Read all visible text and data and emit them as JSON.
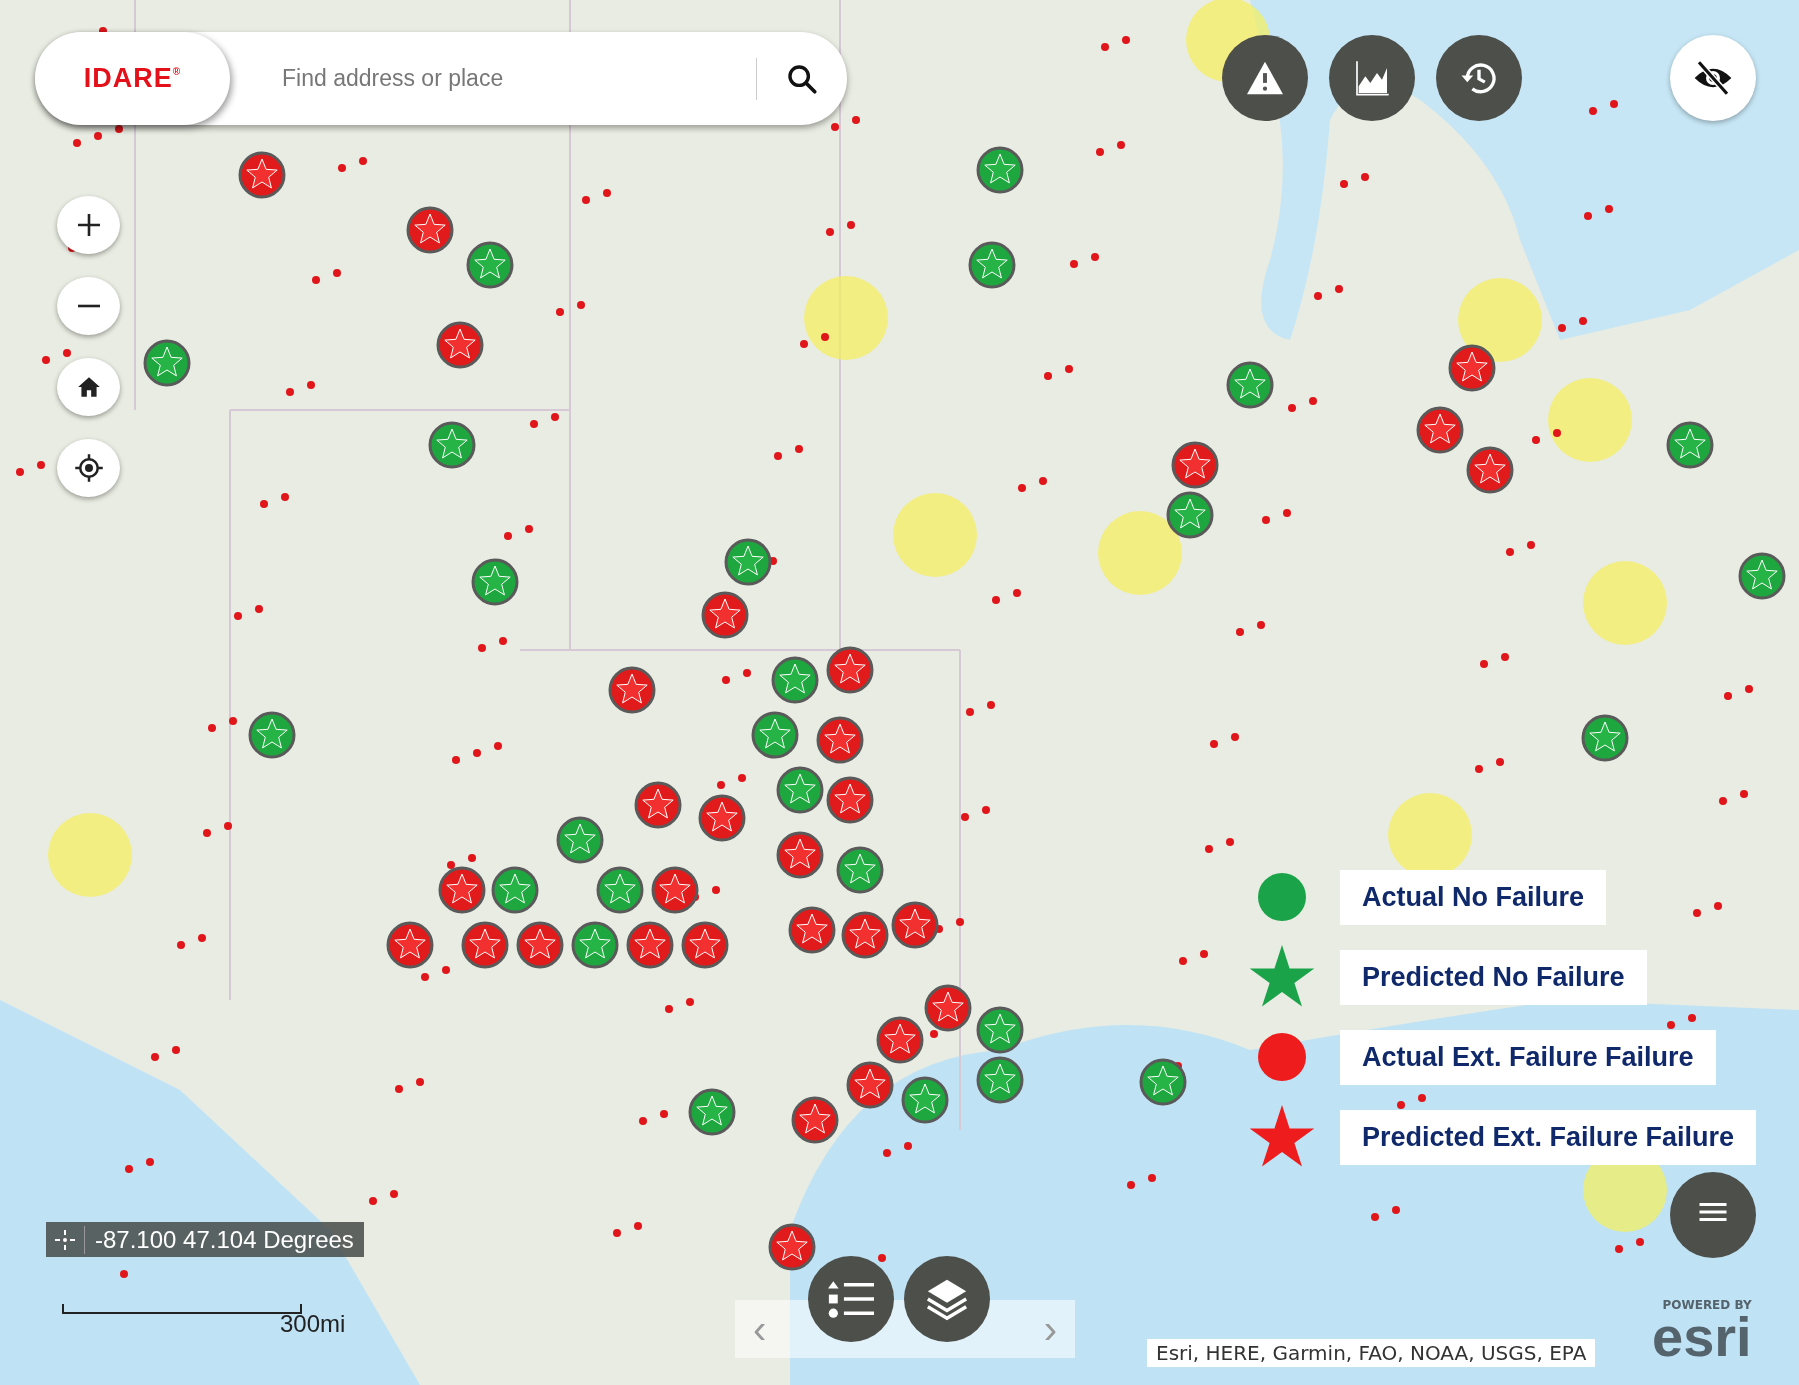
{
  "header": {
    "logo": "IDARE",
    "logo_mark": "®",
    "search": {
      "placeholder": "Find address or place"
    }
  },
  "legend": [
    {
      "kind": "circle",
      "color": "#1ba34a",
      "label": "Actual No Failure"
    },
    {
      "kind": "star",
      "color": "#1ba34a",
      "label": "Predicted No Failure"
    },
    {
      "kind": "circle",
      "color": "#ee1c1c",
      "label": "Actual Ext. Failure Failure"
    },
    {
      "kind": "star",
      "color": "#ee1c1c",
      "label": "Predicted Ext. Failure Failure"
    }
  ],
  "coordinates": "-87.100 47.104 Degrees",
  "scale": "300mi",
  "pager": {
    "prev": "‹",
    "next": "›"
  },
  "attribution": "Esri, HERE, Garmin, FAO, NOAA, USGS, EPA",
  "powered_by": {
    "caption": "POWERED BY",
    "brand": "esri"
  }
}
